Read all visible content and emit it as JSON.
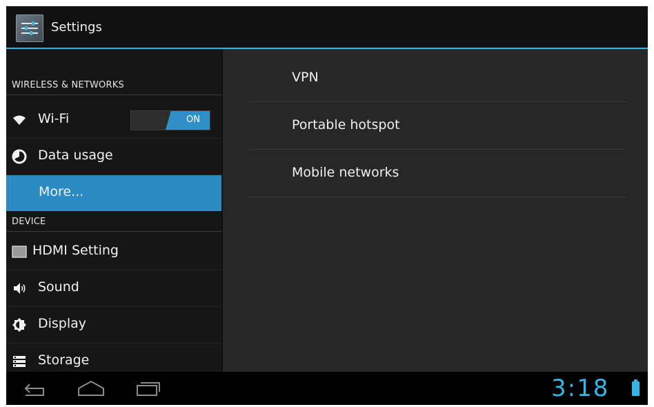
{
  "action_bar": {
    "title": "Settings",
    "icon": "settings-app-icon"
  },
  "sidebar": {
    "sections": [
      {
        "header": "WIRELESS & NETWORKS",
        "items": [
          {
            "label": "Wi-Fi",
            "icon": "wifi-icon",
            "toggle": "ON"
          },
          {
            "label": "Data usage",
            "icon": "data-usage-icon"
          },
          {
            "label": "More...",
            "icon": "",
            "selected": true
          }
        ]
      },
      {
        "header": "DEVICE",
        "items": [
          {
            "label": "HDMI Setting",
            "icon": "hdmi-icon"
          },
          {
            "label": "Sound",
            "icon": "speaker-icon"
          },
          {
            "label": "Display",
            "icon": "brightness-icon"
          },
          {
            "label": "Storage",
            "icon": "storage-icon"
          }
        ]
      }
    ]
  },
  "detail": {
    "items": [
      {
        "label": "VPN"
      },
      {
        "label": "Portable hotspot"
      },
      {
        "label": "Mobile networks"
      }
    ]
  },
  "system_bar": {
    "buttons": [
      "back-icon",
      "home-icon",
      "recent-apps-icon"
    ],
    "clock": "3:18",
    "battery_icon": "battery-icon"
  },
  "colors": {
    "accent": "#33b5e5",
    "selected": "#2b8ac2"
  }
}
